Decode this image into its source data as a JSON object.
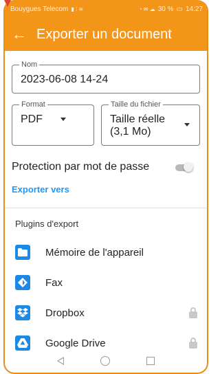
{
  "status_bar": {
    "carrier": "Bouygues Telecom",
    "battery": "30 %",
    "time": "14:27"
  },
  "app_bar": {
    "title": "Exporter un document"
  },
  "form": {
    "name_label": "Nom",
    "name_value": "2023-06-08 14-24",
    "format_label": "Format",
    "format_value": "PDF",
    "size_label": "Taille du fichier",
    "size_value_line1": "Taille réelle",
    "size_value_line2": "(3,1 Mo)",
    "password_label": "Protection par mot de passe",
    "password_enabled": false,
    "export_to_label": "Exporter vers"
  },
  "plugins": {
    "title": "Plugins d'export",
    "items": [
      {
        "label": "Mémoire de l'appareil",
        "icon": "folder-icon",
        "locked": false
      },
      {
        "label": "Fax",
        "icon": "fax-icon",
        "locked": false
      },
      {
        "label": "Dropbox",
        "icon": "dropbox-icon",
        "locked": true
      },
      {
        "label": "Google Drive",
        "icon": "google-drive-icon",
        "locked": true
      }
    ]
  },
  "colors": {
    "accent": "#f39519",
    "link": "#2196f3",
    "icon_blue": "#1e88e5"
  }
}
